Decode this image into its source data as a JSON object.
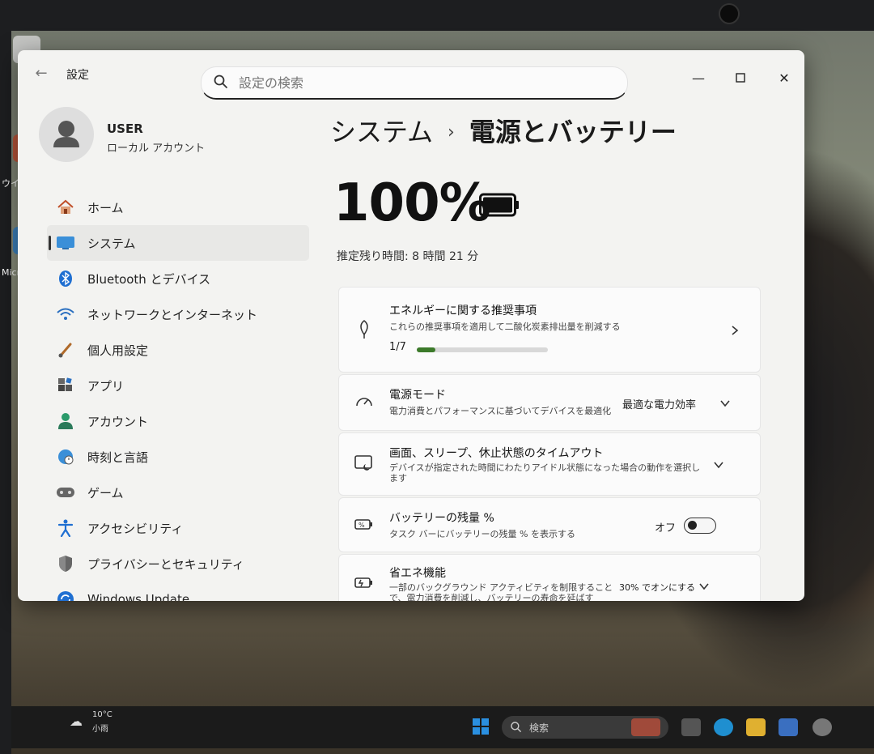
{
  "window": {
    "app_title": "設定",
    "search_placeholder": "設定の検索"
  },
  "user": {
    "name": "USER",
    "account_type": "ローカル アカウント"
  },
  "sidebar": {
    "items": [
      {
        "label": "ホーム",
        "icon": "home-icon"
      },
      {
        "label": "システム",
        "icon": "monitor-icon",
        "active": true
      },
      {
        "label": "Bluetooth とデバイス",
        "icon": "bluetooth-icon"
      },
      {
        "label": "ネットワークとインターネット",
        "icon": "wifi-icon"
      },
      {
        "label": "個人用設定",
        "icon": "brush-icon"
      },
      {
        "label": "アプリ",
        "icon": "apps-icon"
      },
      {
        "label": "アカウント",
        "icon": "person-icon"
      },
      {
        "label": "時刻と言語",
        "icon": "globe-clock-icon"
      },
      {
        "label": "ゲーム",
        "icon": "gamepad-icon"
      },
      {
        "label": "アクセシビリティ",
        "icon": "accessibility-icon"
      },
      {
        "label": "プライバシーとセキュリティ",
        "icon": "shield-icon"
      },
      {
        "label": "Windows Update",
        "icon": "update-icon"
      }
    ]
  },
  "content": {
    "breadcrumb_parent": "システム",
    "breadcrumb_sep": "›",
    "breadcrumb_current": "電源とバッテリー",
    "battery_percent": "100%",
    "battery_level": 1.0,
    "remaining_time": "推定残り時間: 8 時間 21 分"
  },
  "cards": {
    "energy": {
      "title": "エネルギーに関する推奨事項",
      "subtitle": "これらの推奨事項を適用して二酸化炭素排出量を削減する",
      "progress_text": "1/7",
      "progress_fraction": 0.142
    },
    "power_mode": {
      "title": "電源モード",
      "subtitle": "電力消費とパフォーマンスに基づいてデバイスを最適化",
      "value": "最適な電力効率"
    },
    "timeout": {
      "title": "画面、スリープ、休止状態のタイムアウト",
      "subtitle": "デバイスが指定された時間にわたりアイドル状態になった場合の動作を選択します"
    },
    "battery_percent_setting": {
      "title": "バッテリーの残量 %",
      "subtitle": "タスク バーにバッテリーの残量 % を表示する",
      "toggle_state": "オフ"
    },
    "energy_saver": {
      "title": "省エネ機能",
      "subtitle": "一部のバックグラウンド アクティビティを制限することで、電力消費を削減し、バッテリーの寿命を延ばす",
      "value": "30% でオンにする"
    }
  },
  "taskbar": {
    "temperature": "10°C",
    "weather": "小雨",
    "search_label": "検索"
  },
  "desktop": {
    "label_1": "ウイルス",
    "label_2": "Micro"
  },
  "colors": {
    "accent_blue": "#0067c0",
    "progress_green": "#3c7a2a",
    "window_bg": "#f3f3f1"
  }
}
